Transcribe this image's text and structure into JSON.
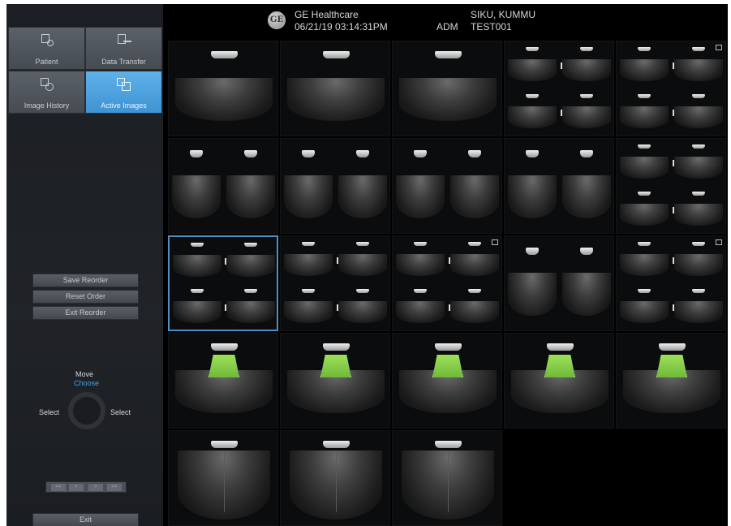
{
  "header": {
    "logo_text": "GE",
    "company": "GE Healthcare",
    "datetime": "06/21/19 03:14:31PM",
    "operator": "ADM",
    "patient_name": "SIKU, KUMMU",
    "patient_id": "TEST001"
  },
  "nav": {
    "patient": {
      "label": "Patient",
      "icon": "patient-icon"
    },
    "data_transfer": {
      "label": "Data Transfer",
      "icon": "data-transfer-icon"
    },
    "image_history": {
      "label": "Image History",
      "icon": "image-history-icon"
    },
    "active_images": {
      "label": "Active Images",
      "icon": "active-images-icon",
      "active": true
    }
  },
  "actions": {
    "save_reorder": "Save Reorder",
    "reset_order": "Reset Order",
    "exit_reorder": "Exit Reorder"
  },
  "trackball": {
    "move": "Move",
    "choose": "Choose",
    "select_left": "Select",
    "select_right": "Select"
  },
  "cine": {
    "buttons": [
      "<<",
      "<",
      ">",
      ">>"
    ]
  },
  "exit_label": "Exit",
  "colors": {
    "accent": "#4a9fe0",
    "selected_border": "#4f8fc4",
    "color_doppler": "#8fd24e"
  },
  "grid": {
    "rows": [
      {
        "cells": [
          "single",
          "single",
          "single",
          "quad",
          "quad"
        ]
      },
      {
        "cells": [
          "dual",
          "dual",
          "dual",
          "dual",
          "quad"
        ]
      },
      {
        "cells": [
          "quad",
          "quad",
          "quad",
          "dual",
          "quad"
        ],
        "selected_index": 0
      },
      {
        "cells": [
          "color",
          "color",
          "color",
          "color",
          "color"
        ]
      },
      {
        "cells": [
          "mmode",
          "mmode",
          "mmode",
          "empty",
          "empty"
        ]
      }
    ]
  }
}
